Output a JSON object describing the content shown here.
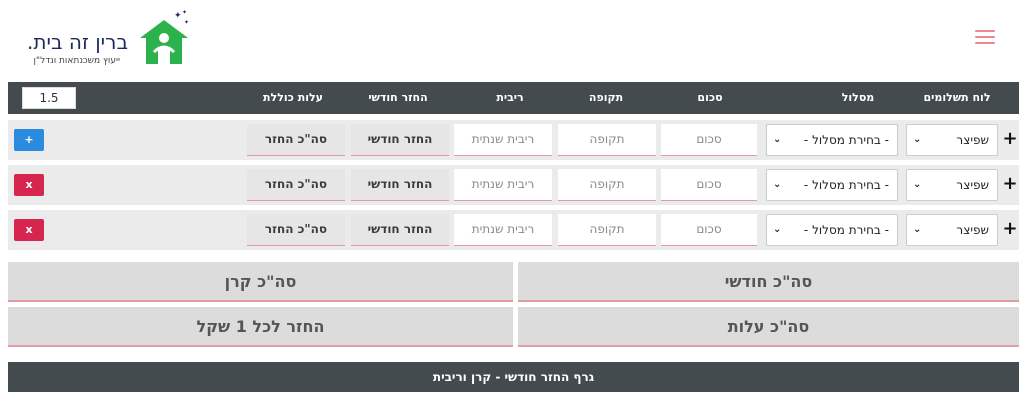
{
  "brand": {
    "name": "ברין זה בית.",
    "tagline": "ייעוץ משכנתאות ונדל\"ן",
    "colors": {
      "navy": "#1c2b5a",
      "green": "#2bb24c",
      "accent": "#e98a8f"
    }
  },
  "menu_icon": "hamburger-icon",
  "header": {
    "schedule": "לוח תשלומים",
    "track": "מסלול",
    "amount": "סכום",
    "period": "תקופה",
    "interest": "ריבית",
    "monthly": "החזר חודשי",
    "total_cost": "עלות כוללת",
    "multiplier_value": "1.5"
  },
  "rows": [
    {
      "schedule": "שפיצר",
      "track": "- בחירת מסלול -",
      "amount": "סכום",
      "period": "תקופה",
      "interest": "ריבית שנתית",
      "monthly": "החזר חודשי",
      "total": "סה\"כ החזר",
      "action": "+",
      "plus": "+"
    },
    {
      "schedule": "שפיצר",
      "track": "- בחירת מסלול -",
      "amount": "סכום",
      "period": "תקופה",
      "interest": "ריבית שנתית",
      "monthly": "החזר חודשי",
      "total": "סה\"כ החזר",
      "action": "x",
      "plus": "+"
    },
    {
      "schedule": "שפיצר",
      "track": "- בחירת מסלול -",
      "amount": "סכום",
      "period": "תקופה",
      "interest": "ריבית שנתית",
      "monthly": "החזר חודשי",
      "total": "סה\"כ החזר",
      "action": "x",
      "plus": "+"
    }
  ],
  "totals": {
    "monthly": "סה\"כ חודשי",
    "principal": "סה\"כ קרן",
    "costs": "סה\"כ עלות",
    "per_shekel": "החזר לכל 1 שקל"
  },
  "graph_title": "גרף החזר חודשי - קרן וריבית"
}
